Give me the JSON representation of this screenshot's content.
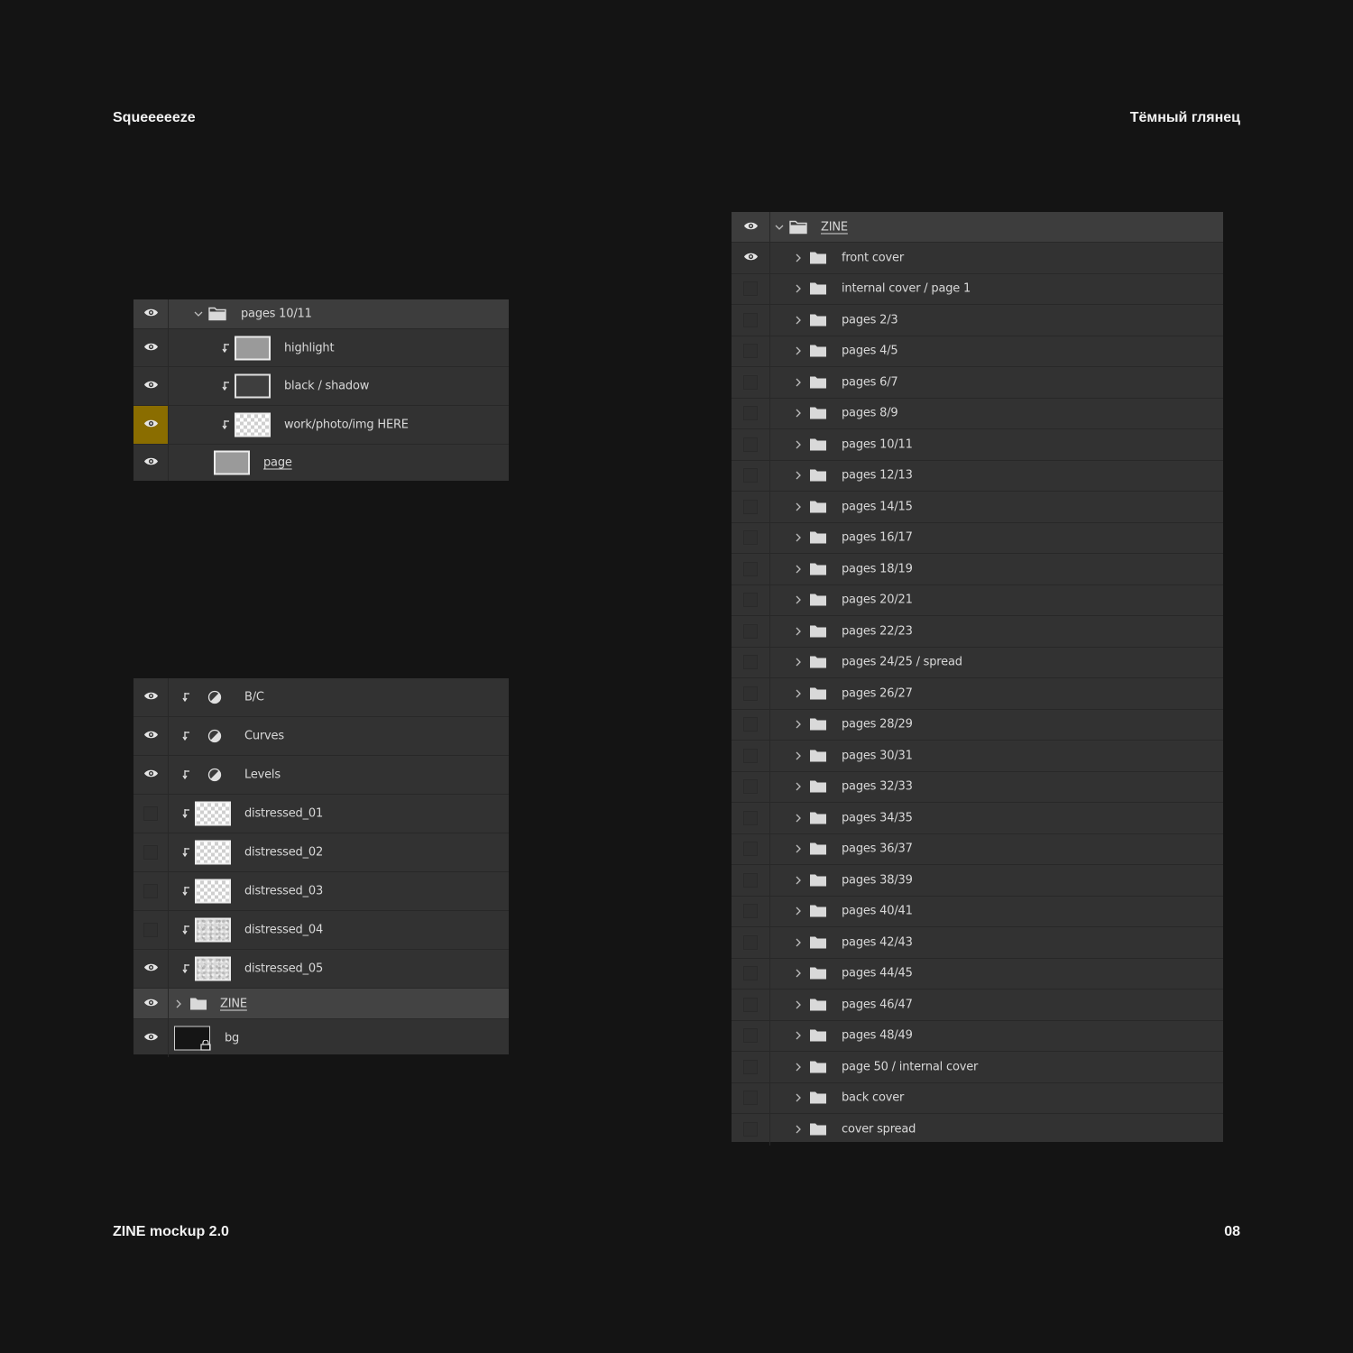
{
  "header": {
    "brand": "Squeeeeeze",
    "finish": "Тёмный глянец"
  },
  "footer": {
    "product": "ZINE mockup 2.0",
    "page_number": "08"
  },
  "colors": {
    "background": "#141414",
    "panel": "#323232",
    "selected_visibility": "#8a6d00",
    "text": "#d8d8d8"
  },
  "panel_a": {
    "group": {
      "label": "pages 10/11",
      "expanded": true,
      "visible": true
    },
    "layers": [
      {
        "label": "highlight",
        "visible": true,
        "clipped": true,
        "thumb": "grey"
      },
      {
        "label": "black / shadow",
        "visible": true,
        "clipped": true,
        "thumb": "dark"
      },
      {
        "label": "work/photo/img HERE",
        "visible": true,
        "clipped": true,
        "thumb": "checker",
        "selected_visibility": true
      },
      {
        "label": "page",
        "visible": true,
        "clipped": false,
        "thumb": "grey"
      }
    ]
  },
  "panel_b": {
    "layers": [
      {
        "label": "B/C",
        "visible": true,
        "type": "adjustment"
      },
      {
        "label": "Curves",
        "visible": true,
        "type": "adjustment"
      },
      {
        "label": "Levels",
        "visible": true,
        "type": "adjustment"
      },
      {
        "label": "distressed_01",
        "visible": false,
        "type": "checker"
      },
      {
        "label": "distressed_02",
        "visible": false,
        "type": "checker"
      },
      {
        "label": "distressed_03",
        "visible": false,
        "type": "checker"
      },
      {
        "label": "distressed_04",
        "visible": false,
        "type": "noise"
      },
      {
        "label": "distressed_05",
        "visible": true,
        "type": "noise"
      }
    ],
    "zine_group": {
      "label": "ZINE",
      "visible": true,
      "expanded": false
    },
    "bg_layer": {
      "label": "bg",
      "visible": true
    }
  },
  "panel_c": {
    "group": {
      "label": "ZINE",
      "expanded": true,
      "visible": true
    },
    "folders": [
      {
        "label": "front cover",
        "visible": true
      },
      {
        "label": "internal cover / page 1",
        "visible": false
      },
      {
        "label": "pages 2/3",
        "visible": false
      },
      {
        "label": "pages 4/5",
        "visible": false
      },
      {
        "label": "pages 6/7",
        "visible": false
      },
      {
        "label": "pages 8/9",
        "visible": false
      },
      {
        "label": "pages 10/11",
        "visible": false
      },
      {
        "label": "pages 12/13",
        "visible": false
      },
      {
        "label": "pages 14/15",
        "visible": false
      },
      {
        "label": "pages 16/17",
        "visible": false
      },
      {
        "label": "pages 18/19",
        "visible": false
      },
      {
        "label": "pages 20/21",
        "visible": false
      },
      {
        "label": "pages 22/23",
        "visible": false
      },
      {
        "label": "pages 24/25 / spread",
        "visible": false
      },
      {
        "label": "pages 26/27",
        "visible": false
      },
      {
        "label": "pages 28/29",
        "visible": false
      },
      {
        "label": "pages 30/31",
        "visible": false
      },
      {
        "label": "pages 32/33",
        "visible": false
      },
      {
        "label": "pages 34/35",
        "visible": false
      },
      {
        "label": "pages 36/37",
        "visible": false
      },
      {
        "label": "pages 38/39",
        "visible": false
      },
      {
        "label": "pages 40/41",
        "visible": false
      },
      {
        "label": "pages 42/43",
        "visible": false
      },
      {
        "label": "pages 44/45",
        "visible": false
      },
      {
        "label": "pages 46/47",
        "visible": false
      },
      {
        "label": "pages 48/49",
        "visible": false
      },
      {
        "label": "page 50 / internal cover",
        "visible": false
      },
      {
        "label": "back cover",
        "visible": false
      },
      {
        "label": "cover spread",
        "visible": false
      }
    ]
  }
}
